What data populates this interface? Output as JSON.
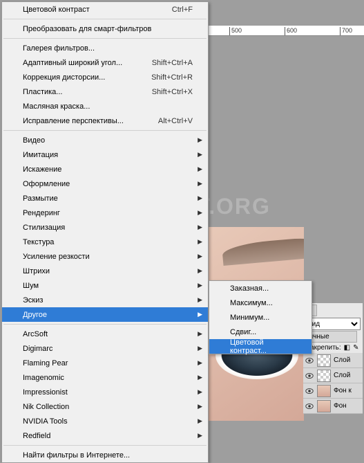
{
  "ruler_marks": [
    "500",
    "600",
    "700"
  ],
  "menu": {
    "items": [
      {
        "label": "Цветовой контраст",
        "shortcut": "Ctrl+F",
        "arrow": false,
        "sep_after": true
      },
      {
        "label": "Преобразовать для смарт-фильтров",
        "shortcut": "",
        "arrow": false,
        "sep_after": true
      },
      {
        "label": "Галерея фильтров...",
        "shortcut": "",
        "arrow": false
      },
      {
        "label": "Адаптивный широкий угол...",
        "shortcut": "Shift+Ctrl+A",
        "arrow": false
      },
      {
        "label": "Коррекция дисторсии...",
        "shortcut": "Shift+Ctrl+R",
        "arrow": false
      },
      {
        "label": "Пластика...",
        "shortcut": "Shift+Ctrl+X",
        "arrow": false
      },
      {
        "label": "Масляная краска...",
        "shortcut": "",
        "arrow": false
      },
      {
        "label": "Исправление перспективы...",
        "shortcut": "Alt+Ctrl+V",
        "arrow": false,
        "sep_after": true
      },
      {
        "label": "Видео",
        "shortcut": "",
        "arrow": true
      },
      {
        "label": "Имитация",
        "shortcut": "",
        "arrow": true
      },
      {
        "label": "Искажение",
        "shortcut": "",
        "arrow": true
      },
      {
        "label": "Оформление",
        "shortcut": "",
        "arrow": true
      },
      {
        "label": "Размытие",
        "shortcut": "",
        "arrow": true
      },
      {
        "label": "Рендеринг",
        "shortcut": "",
        "arrow": true
      },
      {
        "label": "Стилизация",
        "shortcut": "",
        "arrow": true
      },
      {
        "label": "Текстура",
        "shortcut": "",
        "arrow": true
      },
      {
        "label": "Усиление резкости",
        "shortcut": "",
        "arrow": true
      },
      {
        "label": "Штрихи",
        "shortcut": "",
        "arrow": true
      },
      {
        "label": "Шум",
        "shortcut": "",
        "arrow": true
      },
      {
        "label": "Эскиз",
        "shortcut": "",
        "arrow": true
      },
      {
        "label": "Другое",
        "shortcut": "",
        "arrow": true,
        "highlighted": true,
        "sep_after": true
      },
      {
        "label": "ArcSoft",
        "shortcut": "",
        "arrow": true
      },
      {
        "label": "Digimarc",
        "shortcut": "",
        "arrow": true
      },
      {
        "label": "Flaming Pear",
        "shortcut": "",
        "arrow": true
      },
      {
        "label": "Imagenomic",
        "shortcut": "",
        "arrow": true
      },
      {
        "label": "Impressionist",
        "shortcut": "",
        "arrow": true
      },
      {
        "label": "Nik Collection",
        "shortcut": "",
        "arrow": true
      },
      {
        "label": "NVIDIA Tools",
        "shortcut": "",
        "arrow": true
      },
      {
        "label": "Redfield",
        "shortcut": "",
        "arrow": true,
        "sep_after": true
      },
      {
        "label": "Найти фильтры в Интернете...",
        "shortcut": "",
        "arrow": false
      }
    ]
  },
  "submenu": {
    "items": [
      {
        "label": "Заказная..."
      },
      {
        "label": "Максимум..."
      },
      {
        "label": "Минимум..."
      },
      {
        "label": "Сдвиг..."
      },
      {
        "label": "Цветовой контраст...",
        "highlighted": true
      }
    ]
  },
  "panel": {
    "tab1": "и",
    "mode": "Вид",
    "tab2": "ычные",
    "lock_label": "Закрепить:",
    "layers": [
      {
        "name": "Слой"
      },
      {
        "name": "Слой"
      },
      {
        "name": "Фон к"
      },
      {
        "name": "Фон"
      }
    ]
  },
  "watermark": "KAK-SDELAT.ORG"
}
